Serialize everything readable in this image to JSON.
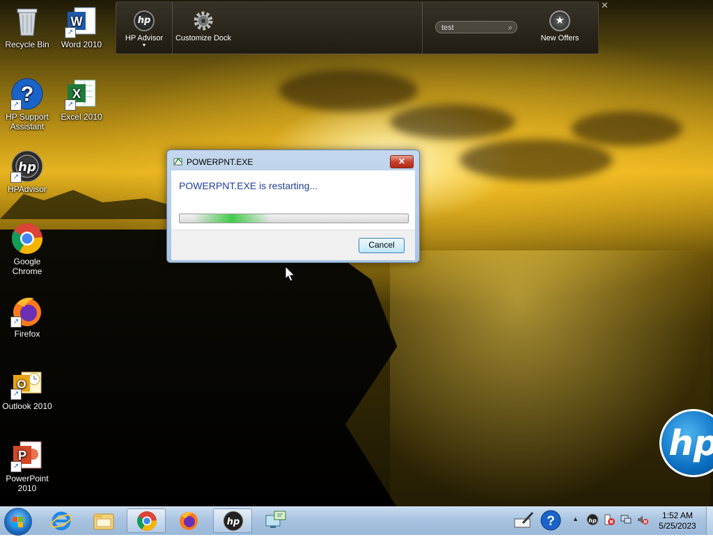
{
  "desktop_icons": [
    {
      "label": "Recycle Bin",
      "icon": "recycle-bin-icon"
    },
    {
      "label": "Word 2010",
      "icon": "word-icon"
    },
    {
      "label": "HP Support Assistant",
      "icon": "hp-support-icon"
    },
    {
      "label": "Excel 2010",
      "icon": "excel-icon"
    },
    {
      "label": "HPAdvisor",
      "icon": "hp-advisor-icon"
    },
    {
      "label": "Google Chrome",
      "icon": "chrome-icon"
    },
    {
      "label": "Firefox",
      "icon": "firefox-icon"
    },
    {
      "label": "Outlook 2010",
      "icon": "outlook-icon"
    },
    {
      "label": "PowerPoint 2010",
      "icon": "powerpoint-icon"
    }
  ],
  "dock": {
    "hp_advisor_label": "HP Advisor",
    "customize_label": "Customize Dock",
    "search_value": "test",
    "new_offers_label": "New Offers"
  },
  "dialog": {
    "title": "POWERPNT.EXE",
    "message": "POWERPNT.EXE is restarting...",
    "close_glyph": "✕",
    "cancel_label": "Cancel"
  },
  "brand": {
    "logo_text": "hp"
  },
  "taskbar": {
    "items": [
      "start-orb-icon",
      "ie-icon",
      "explorer-icon",
      "chrome-icon",
      "firefox-icon",
      "hp-icon",
      "network-computer-icon"
    ],
    "clock_time": "1:52 AM",
    "clock_date": "5/25/2023"
  },
  "colors": {
    "accent": "#1e3f9a",
    "close_red": "#c7402a",
    "progress_green": "#32c83c"
  }
}
